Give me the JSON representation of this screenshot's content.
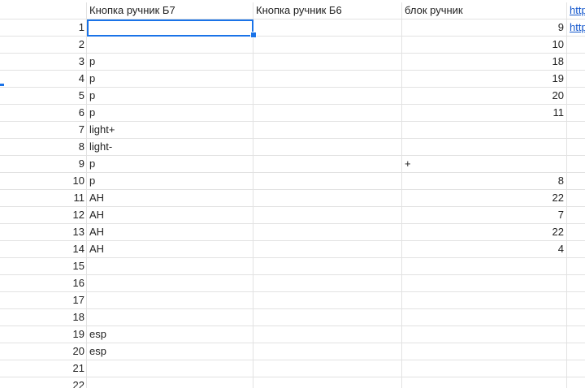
{
  "header": {
    "col_a": "Кнопка ручник Б7",
    "col_b": "Кнопка ручник Б6",
    "col_c": "блок ручник",
    "col_d": "http"
  },
  "rows": [
    {
      "num": "1",
      "a": "",
      "b": "",
      "c": "9",
      "d": "http"
    },
    {
      "num": "2",
      "a": "",
      "b": "",
      "c": "10",
      "d": ""
    },
    {
      "num": "3",
      "a": "p",
      "b": "",
      "c": "18",
      "d": ""
    },
    {
      "num": "4",
      "a": "p",
      "b": "",
      "c": "19",
      "d": ""
    },
    {
      "num": "5",
      "a": "p",
      "b": "",
      "c": "20",
      "d": ""
    },
    {
      "num": "6",
      "a": "p",
      "b": "",
      "c": "11",
      "d": ""
    },
    {
      "num": "7",
      "a": "light+",
      "b": "",
      "c": "",
      "d": ""
    },
    {
      "num": "8",
      "a": "light-",
      "b": "",
      "c": "",
      "d": ""
    },
    {
      "num": "9",
      "a": "p",
      "b": "",
      "c": "+",
      "d": ""
    },
    {
      "num": "10",
      "a": "p",
      "b": "",
      "c": "8",
      "d": ""
    },
    {
      "num": "11",
      "a": "AH",
      "b": "",
      "c": "22",
      "d": ""
    },
    {
      "num": "12",
      "a": "AH",
      "b": "",
      "c": "7",
      "d": ""
    },
    {
      "num": "13",
      "a": "AH",
      "b": "",
      "c": "22",
      "d": ""
    },
    {
      "num": "14",
      "a": "AH",
      "b": "",
      "c": "4",
      "d": ""
    },
    {
      "num": "15",
      "a": "",
      "b": "",
      "c": "",
      "d": ""
    },
    {
      "num": "16",
      "a": "",
      "b": "",
      "c": "",
      "d": ""
    },
    {
      "num": "17",
      "a": "",
      "b": "",
      "c": "",
      "d": ""
    },
    {
      "num": "18",
      "a": "",
      "b": "",
      "c": "",
      "d": ""
    },
    {
      "num": "19",
      "a": "esp",
      "b": "",
      "c": "",
      "d": ""
    },
    {
      "num": "20",
      "a": "esp",
      "b": "",
      "c": "",
      "d": ""
    },
    {
      "num": "21",
      "a": "",
      "b": "",
      "c": "",
      "d": ""
    },
    {
      "num": "22",
      "a": "",
      "b": "",
      "c": "",
      "d": ""
    }
  ],
  "colors": {
    "selection": "#1a73e8",
    "link": "#1155cc",
    "grid": "#e2e2e2"
  }
}
